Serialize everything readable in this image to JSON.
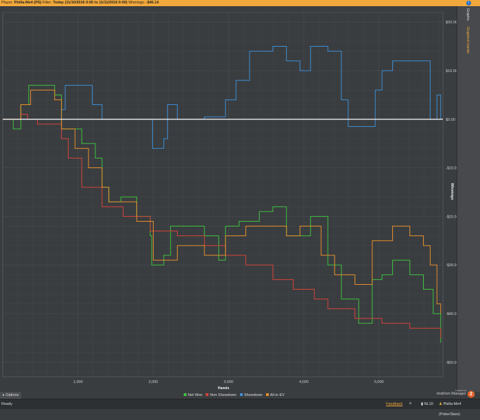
{
  "header": {
    "player_label": "Player:",
    "player": "Pbilla-Me4 (PS)",
    "filter_label": "Filter:",
    "filter": "Today (11/10/2016 0:00 to 11/11/2016 0:00)",
    "winnings_label": "Winnings:",
    "winnings": "-$46.14",
    "info_icon": "i"
  },
  "side_tabs": {
    "graphs": "Graphs",
    "graphed_hands": "Graphed Hands"
  },
  "options_label": "Options",
  "brand": {
    "powered": "Powered by",
    "name": "Hold'em Manager",
    "logo": "2"
  },
  "status": {
    "ready": "Ready",
    "feedback": "Feedback",
    "stake": "NL10",
    "player": "Pbilla-Me4 (PokerStars)"
  },
  "chart_data": {
    "type": "line",
    "xlabel": "Hands",
    "ylabel": "Winnings",
    "xlim": [
      0,
      5850
    ],
    "ylim": [
      -53,
      22
    ],
    "xticks": [
      1000,
      2000,
      3000,
      4000,
      5000
    ],
    "xtick_labels": [
      "1,000",
      "2,000",
      "3,000",
      "4,000",
      "5,000"
    ],
    "yticks": [
      20,
      10,
      0,
      -10,
      -20,
      -30,
      -40,
      -50
    ],
    "ytick_labels": [
      "$20.00",
      "$10.00",
      "$0.00",
      "-$10.00",
      "-$20.00",
      "-$30.00",
      "-$40.00",
      "-$50.00"
    ],
    "grid": true,
    "legend": "bottom-center",
    "series": [
      {
        "name": "Net Won",
        "color": "#3ec43e",
        "points": [
          [
            0,
            0
          ],
          [
            140,
            -2
          ],
          [
            240,
            3
          ],
          [
            345,
            7
          ],
          [
            690,
            5
          ],
          [
            780,
            -2
          ],
          [
            1050,
            -5
          ],
          [
            1230,
            -8
          ],
          [
            1320,
            -14
          ],
          [
            1410,
            -17
          ],
          [
            1570,
            -16
          ],
          [
            1780,
            -20
          ],
          [
            1960,
            -24
          ],
          [
            1980,
            -30
          ],
          [
            2140,
            -28
          ],
          [
            2230,
            -22
          ],
          [
            2680,
            -24
          ],
          [
            2870,
            -29
          ],
          [
            2960,
            -22
          ],
          [
            3140,
            -21
          ],
          [
            3410,
            -19
          ],
          [
            3590,
            -18
          ],
          [
            3770,
            -24
          ],
          [
            4090,
            -20
          ],
          [
            4320,
            -30
          ],
          [
            4500,
            -37
          ],
          [
            4730,
            -42
          ],
          [
            4910,
            -33
          ],
          [
            5040,
            -32
          ],
          [
            5180,
            -29
          ],
          [
            5410,
            -32
          ],
          [
            5590,
            -35
          ],
          [
            5720,
            -40
          ],
          [
            5820,
            -46
          ]
        ]
      },
      {
        "name": "Non Showdown",
        "color": "#d9433a",
        "points": [
          [
            0,
            0
          ],
          [
            240,
            1
          ],
          [
            330,
            0
          ],
          [
            460,
            -1
          ],
          [
            690,
            -1
          ],
          [
            780,
            -4
          ],
          [
            870,
            -8
          ],
          [
            1050,
            -14
          ],
          [
            1320,
            -18
          ],
          [
            1600,
            -20
          ],
          [
            1960,
            -23
          ],
          [
            2320,
            -24
          ],
          [
            2680,
            -26
          ],
          [
            2960,
            -28
          ],
          [
            3230,
            -30
          ],
          [
            3590,
            -33
          ],
          [
            3860,
            -35
          ],
          [
            4140,
            -37
          ],
          [
            4320,
            -39
          ],
          [
            4680,
            -41
          ],
          [
            5040,
            -42
          ],
          [
            5410,
            -43
          ],
          [
            5820,
            -45
          ]
        ]
      },
      {
        "name": "Showdown",
        "color": "#3c8fd6",
        "points": [
          [
            0,
            0
          ],
          [
            780,
            2
          ],
          [
            830,
            7
          ],
          [
            1140,
            7
          ],
          [
            1190,
            3
          ],
          [
            1320,
            0
          ],
          [
            1960,
            0
          ],
          [
            1990,
            -6
          ],
          [
            2140,
            -4
          ],
          [
            2190,
            3
          ],
          [
            2320,
            0
          ],
          [
            2680,
            0.5
          ],
          [
            2960,
            4
          ],
          [
            3100,
            8
          ],
          [
            3280,
            14
          ],
          [
            3590,
            15
          ],
          [
            3770,
            12
          ],
          [
            3950,
            10
          ],
          [
            4090,
            15
          ],
          [
            4320,
            14
          ],
          [
            4500,
            4
          ],
          [
            4590,
            -1.5
          ],
          [
            4860,
            -1.5
          ],
          [
            4950,
            6
          ],
          [
            5040,
            10
          ],
          [
            5180,
            12
          ],
          [
            5590,
            12
          ],
          [
            5680,
            0
          ],
          [
            5770,
            5
          ],
          [
            5820,
            0
          ]
        ]
      },
      {
        "name": "All-in EV",
        "color": "#e8902c",
        "points": [
          [
            0,
            0
          ],
          [
            240,
            3
          ],
          [
            370,
            6
          ],
          [
            690,
            4
          ],
          [
            780,
            -2
          ],
          [
            960,
            -6
          ],
          [
            1140,
            -10
          ],
          [
            1320,
            -14
          ],
          [
            1410,
            -17
          ],
          [
            1780,
            -21
          ],
          [
            2000,
            -29
          ],
          [
            2320,
            -26
          ],
          [
            2680,
            -28
          ],
          [
            2960,
            -24
          ],
          [
            3230,
            -22
          ],
          [
            3500,
            -22
          ],
          [
            3770,
            -24
          ],
          [
            3950,
            -22
          ],
          [
            4230,
            -28
          ],
          [
            4410,
            -32
          ],
          [
            4680,
            -34
          ],
          [
            4770,
            -34
          ],
          [
            4910,
            -25
          ],
          [
            5180,
            -22
          ],
          [
            5410,
            -24
          ],
          [
            5590,
            -26
          ],
          [
            5680,
            -30
          ],
          [
            5770,
            -38
          ],
          [
            5820,
            -40
          ]
        ]
      }
    ]
  }
}
